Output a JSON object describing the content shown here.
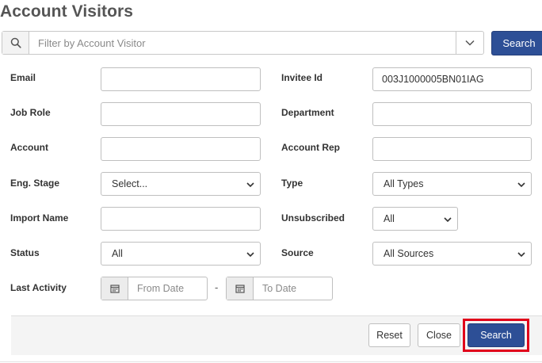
{
  "page": {
    "title": "Account Visitors"
  },
  "filter": {
    "placeholder": "Filter by Account Visitor",
    "search_button": "Search"
  },
  "form": {
    "email": {
      "label": "Email",
      "value": ""
    },
    "invitee_id": {
      "label": "Invitee Id",
      "value": "003J1000005BN01IAG"
    },
    "job_role": {
      "label": "Job Role",
      "value": ""
    },
    "department": {
      "label": "Department",
      "value": ""
    },
    "account": {
      "label": "Account",
      "value": ""
    },
    "account_rep": {
      "label": "Account Rep",
      "value": ""
    },
    "eng_stage": {
      "label": "Eng. Stage",
      "selected": "Select..."
    },
    "type": {
      "label": "Type",
      "selected": "All Types"
    },
    "import_name": {
      "label": "Import Name",
      "value": ""
    },
    "unsubscribed": {
      "label": "Unsubscribed",
      "selected": "All"
    },
    "status": {
      "label": "Status",
      "selected": "All"
    },
    "source": {
      "label": "Source",
      "selected": "All Sources"
    },
    "last_activity": {
      "label": "Last Activity",
      "from_placeholder": "From Date",
      "to_placeholder": "To Date",
      "separator": "-"
    }
  },
  "footer": {
    "reset": "Reset",
    "close": "Close",
    "search": "Search"
  },
  "colors": {
    "primary": "#2d4f96",
    "highlight": "#e0001a"
  }
}
